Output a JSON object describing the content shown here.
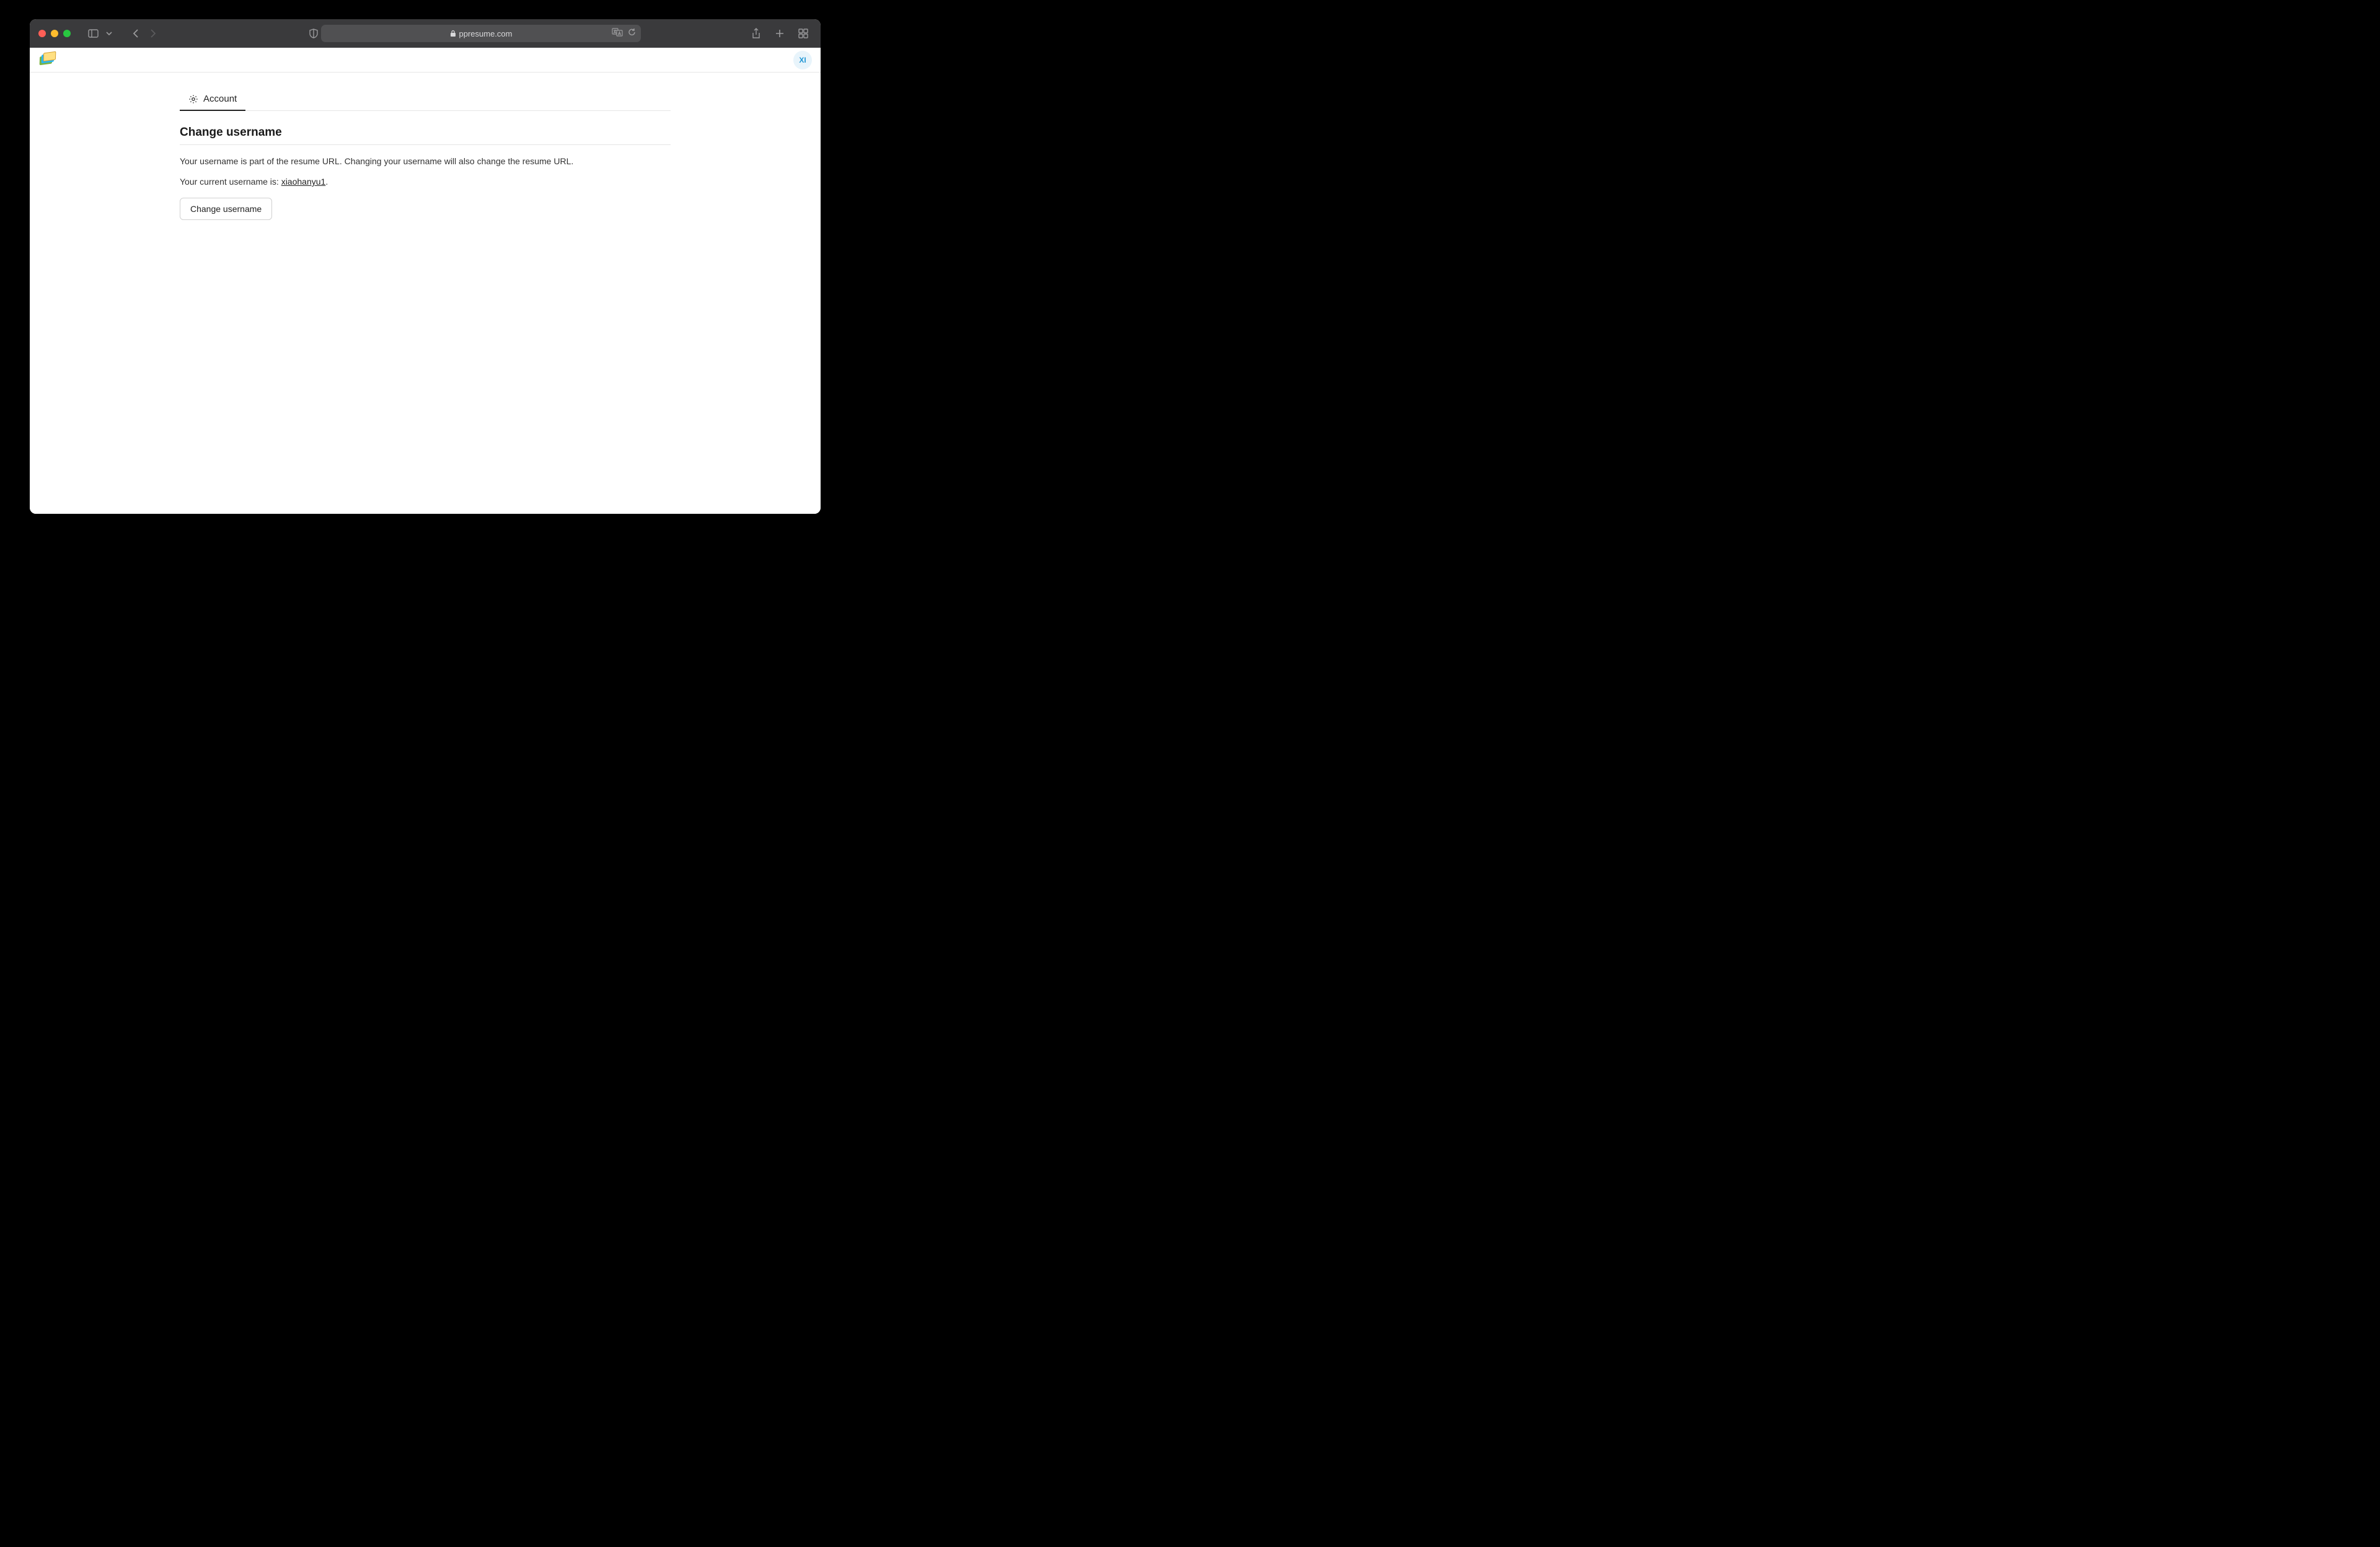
{
  "browser": {
    "url_display": "ppresume.com"
  },
  "header": {
    "avatar_initials": "XI"
  },
  "tabs": [
    {
      "label": "Account",
      "active": true
    }
  ],
  "section": {
    "title": "Change username",
    "description": "Your username is part of the resume URL. Changing your username will also change the resume URL.",
    "current_prefix": "Your current username is: ",
    "current_username": "xiaohanyu1",
    "current_suffix": ".",
    "button_label": "Change username"
  }
}
